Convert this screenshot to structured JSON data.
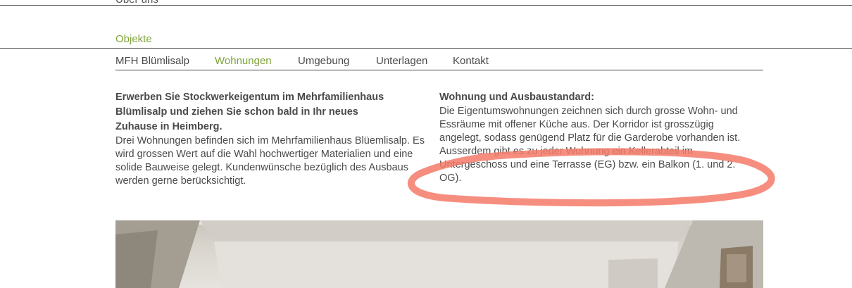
{
  "top": {
    "cut_link": "Über uns"
  },
  "section": {
    "title": "Objekte"
  },
  "nav": {
    "items": [
      {
        "label": "MFH Blümlisalp",
        "active": false
      },
      {
        "label": "Wohnungen",
        "active": true
      },
      {
        "label": "Umgebung",
        "active": false
      },
      {
        "label": "Unterlagen",
        "active": false
      },
      {
        "label": "Kontakt",
        "active": false
      }
    ]
  },
  "content": {
    "left": {
      "heading": "Erwerben Sie Stockwerkeigentum im Mehrfamilienhaus Blümlisalp und ziehen Sie schon bald in Ihr neues Zuhause in Heimberg.",
      "body": "Drei Wohnungen befinden sich im Mehrfamilienhaus Blüemlisalp. Es wird grossen Wert auf die Wahl hochwertiger Materialien und eine solide Bauweise gelegt. Kundenwünsche bezüglich des Ausbaus werden gerne berücksichtigt."
    },
    "right": {
      "heading": "Wohnung und Ausbaustandard:",
      "body1": "Die Eigentumswohnungen zeichnen sich durch grosse Wohn- und Essräume mit offener Küche aus. Der Korridor ist grosszügig angelegt, sodass genügend Platz für die Garderobe vorhanden ist.",
      "body2": "Ausserdem gibt es zu jeder Wohnung ein Kellerabteil im Untergeschoss und eine Terrasse (EG) bzw. ein Balkon (1. und 2. OG)."
    }
  },
  "colors": {
    "accent": "#7fa33a",
    "text": "#4a4a4a",
    "annotation": "#f47a6a"
  }
}
